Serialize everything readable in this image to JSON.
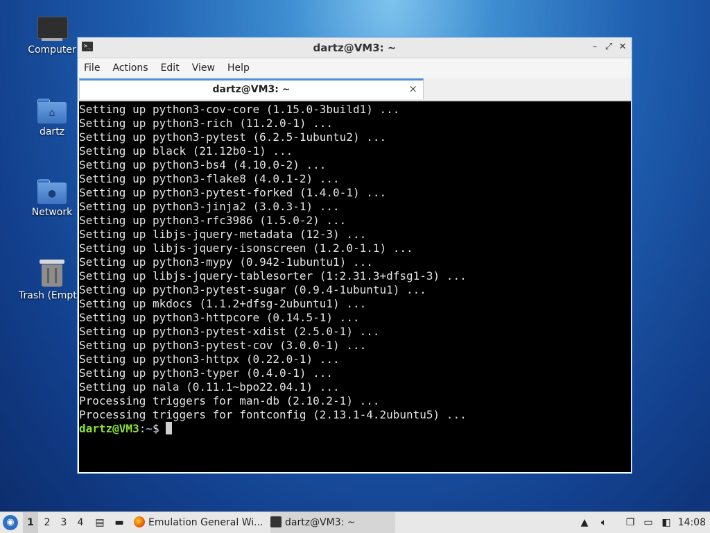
{
  "desktop": {
    "icons": [
      {
        "label": "Computer",
        "icon": "computer-icon"
      },
      {
        "label": "dartz",
        "icon": "home-folder-icon"
      },
      {
        "label": "Network",
        "icon": "network-folder-icon"
      },
      {
        "label": "Trash (Empty)",
        "icon": "trash-icon"
      }
    ]
  },
  "window": {
    "title": "dartz@VM3: ~",
    "menu": [
      "File",
      "Actions",
      "Edit",
      "View",
      "Help"
    ],
    "tab": {
      "label": "dartz@VM3: ~",
      "close": "×"
    },
    "controls": {
      "minimize": "–",
      "maximize": "⤢",
      "close": "✕"
    }
  },
  "terminal": {
    "lines": [
      "Setting up python3-cov-core (1.15.0-3build1) ...",
      "Setting up python3-rich (11.2.0-1) ...",
      "Setting up python3-pytest (6.2.5-1ubuntu2) ...",
      "Setting up black (21.12b0-1) ...",
      "Setting up python3-bs4 (4.10.0-2) ...",
      "Setting up python3-flake8 (4.0.1-2) ...",
      "Setting up python3-pytest-forked (1.4.0-1) ...",
      "Setting up python3-jinja2 (3.0.3-1) ...",
      "Setting up python3-rfc3986 (1.5.0-2) ...",
      "Setting up libjs-jquery-metadata (12-3) ...",
      "Setting up libjs-jquery-isonscreen (1.2.0-1.1) ...",
      "Setting up python3-mypy (0.942-1ubuntu1) ...",
      "Setting up libjs-jquery-tablesorter (1:2.31.3+dfsg1-3) ...",
      "Setting up python3-pytest-sugar (0.9.4-1ubuntu1) ...",
      "Setting up mkdocs (1.1.2+dfsg-2ubuntu1) ...",
      "Setting up python3-httpcore (0.14.5-1) ...",
      "Setting up python3-pytest-xdist (2.5.0-1) ...",
      "Setting up python3-pytest-cov (3.0.0-1) ...",
      "Setting up python3-httpx (0.22.0-1) ...",
      "Setting up python3-typer (0.4.0-1) ...",
      "Setting up nala (0.11.1~bpo22.04.1) ...",
      "Processing triggers for man-db (2.10.2-1) ...",
      "Processing triggers for fontconfig (2.13.1-4.2ubuntu5) ..."
    ],
    "prompt": {
      "user_host": "dartz@VM3",
      "sep": ":",
      "path": "~",
      "symbol": "$ "
    }
  },
  "taskbar": {
    "workspaces": [
      "1",
      "2",
      "3",
      "4"
    ],
    "tasks": [
      {
        "label": "Emulation General Wi...",
        "icon": "firefox-icon"
      },
      {
        "label": "dartz@VM3: ~",
        "icon": "terminal-icon"
      }
    ],
    "clock": "14:08"
  }
}
